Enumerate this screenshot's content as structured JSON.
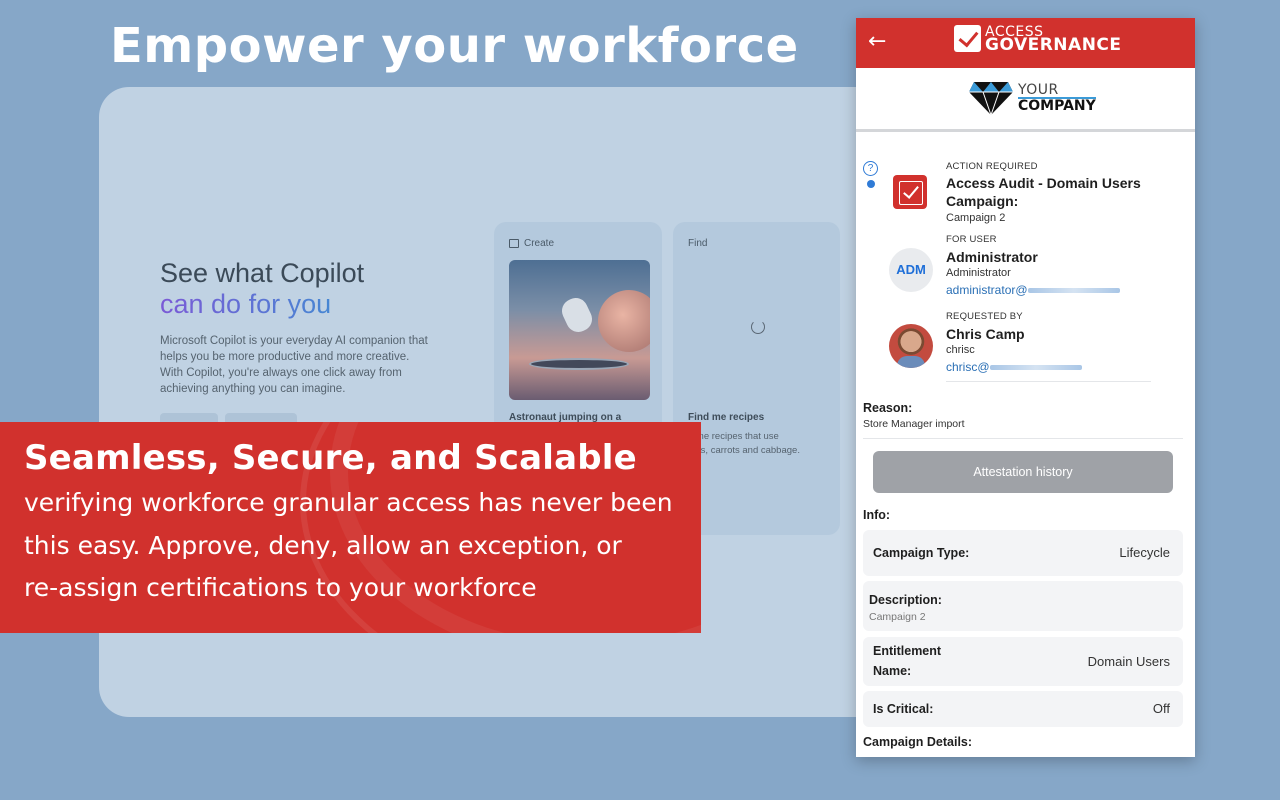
{
  "headline": "Empower your workforce",
  "copilot": {
    "title_line1": "See what Copilot",
    "title_line2": "can do for you",
    "description": "Microsoft Copilot is your everyday AI companion that helps you be more productive and more creative. With Copilot, you're always one click away from achieving anything you can imagine.",
    "tiles": [
      {
        "label": "Create",
        "caption": "Astronaut jumping on a",
        "icon": "image-icon"
      },
      {
        "label": "Find",
        "caption": "Find me recipes",
        "subtext": "d me recipes that use\nions, carrots and cabbage."
      }
    ]
  },
  "banner": {
    "title": "Seamless, Secure, and Scalable",
    "lines": [
      "verifying workforce granular access has never been",
      "this easy.  Approve, deny, allow an exception, or",
      "re-assign certifications to your workforce"
    ]
  },
  "app": {
    "brand_top": "ACCESS",
    "brand_bottom": "GOVERNANCE",
    "company_top": "YOUR",
    "company_bottom": "COMPANY",
    "action_label": "ACTION REQUIRED",
    "campaign_title": "Access Audit - Domain Users Campaign:",
    "campaign_sub": "Campaign 2",
    "for_user_label": "FOR USER",
    "user_avatar": "ADM",
    "user_name": "Administrator",
    "user_role": "Administrator",
    "user_email": "administrator@",
    "requested_by_label": "REQUESTED BY",
    "requester_name": "Chris Camp",
    "requester_login": "chrisc",
    "requester_email": "chrisc@",
    "reason_label": "Reason:",
    "reason_value": "Store Manager import",
    "history_button": "Attestation history",
    "info_label": "Info:",
    "info": {
      "campaign_type_key": "Campaign Type:",
      "campaign_type_val": "Lifecycle",
      "description_key": "Description:",
      "description_val": "Campaign 2",
      "entitlement_key": "Entitlement Name:",
      "entitlement_val": "Domain Users",
      "critical_key": "Is Critical:",
      "critical_val": "Off"
    },
    "details_label": "Campaign Details:"
  },
  "colors": {
    "background": "#86a7c8",
    "brand_red": "#d1312d",
    "link_blue": "#2a6fb5"
  }
}
